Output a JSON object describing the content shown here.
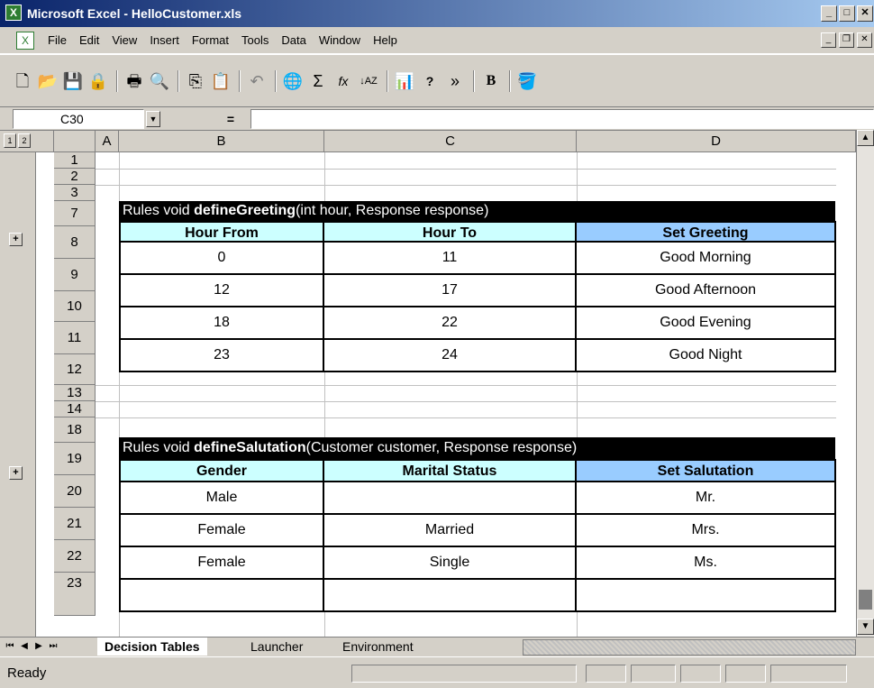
{
  "window": {
    "title": "Microsoft Excel - HelloCustomer.xls",
    "controls": {
      "minimize": "_",
      "restore": "□",
      "close": "✕"
    },
    "mdi_controls": {
      "minimize": "_",
      "restore": "❐",
      "close": "✕"
    }
  },
  "menu": [
    "File",
    "Edit",
    "View",
    "Insert",
    "Format",
    "Tools",
    "Data",
    "Window",
    "Help"
  ],
  "toolbar": {
    "icons": [
      "new-icon",
      "open-icon",
      "save-icon",
      "permission-icon",
      "print-icon",
      "print-preview-icon",
      "copy-icon",
      "paste-icon",
      "undo-icon",
      "hyperlink-icon",
      "autosum-icon",
      "function-icon",
      "sort-ascending-icon",
      "chart-wizard-icon",
      "help-icon",
      "more-buttons-icon",
      "bold-icon",
      "fill-color-icon"
    ],
    "glyphs": {
      "new": "🗋",
      "open": "📂",
      "save": "💾",
      "permission": "🔒",
      "print": "🖶",
      "print_preview": "🔍",
      "copy": "⎘",
      "paste": "📋",
      "undo": "↶",
      "hyperlink": "🌐",
      "autosum": "Σ",
      "function": "fx",
      "sort_ascending": "↓AZ",
      "chart_wizard": "📊",
      "help": "?",
      "more": "»",
      "bold": "B",
      "fill_color": "🪣"
    }
  },
  "formula_bar": {
    "name_box": "C30",
    "equals": "=",
    "formula": ""
  },
  "outline": {
    "levels": [
      "1",
      "2"
    ],
    "plus": "+"
  },
  "columns": [
    "A",
    "B",
    "C",
    "D"
  ],
  "rows": [
    "1",
    "2",
    "3",
    "7",
    "8",
    "9",
    "10",
    "11",
    "12",
    "13",
    "14",
    "18",
    "19",
    "20",
    "21",
    "22",
    "23"
  ],
  "greeting_table": {
    "prefix": "Rules void ",
    "method": "defineGreeting",
    "params": "(int hour, Response response)",
    "headers": [
      "Hour From",
      "Hour To",
      "Set Greeting"
    ],
    "rows": [
      [
        "0",
        "11",
        "Good Morning"
      ],
      [
        "12",
        "17",
        "Good Afternoon"
      ],
      [
        "18",
        "22",
        "Good Evening"
      ],
      [
        "23",
        "24",
        "Good Night"
      ]
    ]
  },
  "salutation_table": {
    "prefix": "Rules void ",
    "method": "defineSalutation",
    "params": "(Customer customer, Response response)",
    "headers": [
      "Gender",
      "Marital Status",
      "Set Salutation"
    ],
    "rows": [
      [
        "Male",
        "",
        "Mr."
      ],
      [
        "Female",
        "Married",
        "Mrs."
      ],
      [
        "Female",
        "Single",
        "Ms."
      ],
      [
        "",
        "",
        ""
      ]
    ]
  },
  "sheet_tabs": [
    "Decision Tables",
    "Launcher",
    "Environment"
  ],
  "active_tab": "Decision Tables",
  "status": "Ready",
  "colors": {
    "header_cyan": "#ccffff",
    "header_blue": "#99ccff",
    "title_black": "#000000"
  }
}
